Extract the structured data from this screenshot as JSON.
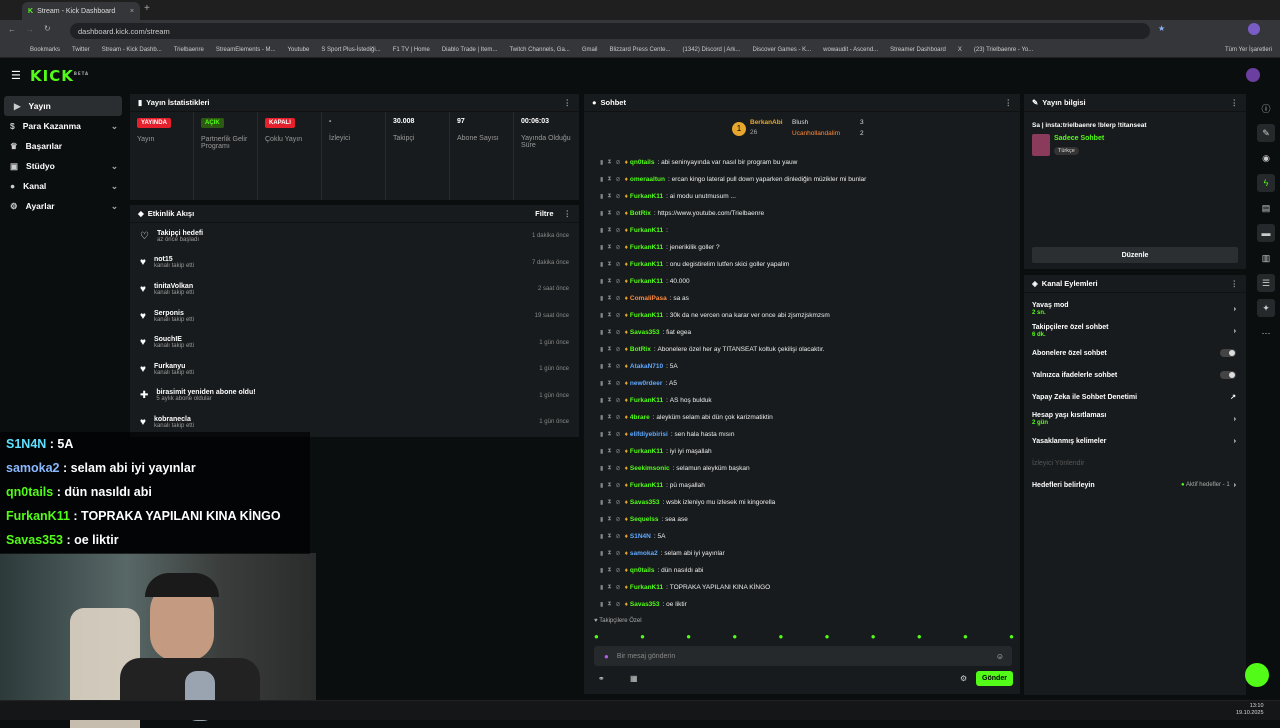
{
  "browser": {
    "tab_title": "Stream - Kick Dashboard",
    "url": "dashboard.kick.com/stream",
    "bookmarks": [
      "Bookmarks",
      "Twitter",
      "Stream - Kick Dashb...",
      "Trielbaenre",
      "StreamElements - M...",
      "Youtube",
      "S Sport Plus-İstediği...",
      "F1 TV | Home",
      "Diablo Trade | Item...",
      "Twitch Channels, Ga...",
      "Gmail",
      "Blizzard Press Cente...",
      "(1342) Discord | Ark...",
      "Discover Games - K...",
      "wowaudit - Ascend...",
      "Streamer Dashboard",
      "X",
      "(23) Trielbaenre - Yo..."
    ],
    "all_bookmarks": "Tüm Yer İşaretleri"
  },
  "app": {
    "logo": "KICK",
    "beta": "BETA"
  },
  "sidebar": {
    "items": [
      {
        "label": "Yayın"
      },
      {
        "label": "Para Kazanma"
      },
      {
        "label": "Başarılar"
      },
      {
        "label": "Stüdyo"
      },
      {
        "label": "Kanal"
      },
      {
        "label": "Ayarlar"
      }
    ]
  },
  "stats": {
    "title": "Yayın İstatistikleri",
    "items": [
      {
        "badge": "YAYINDA",
        "badge_color": "#e5202d",
        "label": "Yayın"
      },
      {
        "badge": "AÇIK",
        "badge_color": "#53fc18",
        "label": "Partnerlik Gelir Programı"
      },
      {
        "badge": "KAPALI",
        "badge_color": "#e5202d",
        "label": "Çoklu Yayın"
      },
      {
        "value": "-",
        "label": "İzleyici"
      },
      {
        "value": "30.008",
        "label": "Takipçi"
      },
      {
        "value": "97",
        "label": "Abone Sayısı"
      },
      {
        "value": "00:06:03",
        "label": "Yayında Olduğu Süre"
      }
    ]
  },
  "activity": {
    "title": "Etkinlik Akışı",
    "filter": "Filtre",
    "items": [
      {
        "name": "Takipçi hedefi",
        "sub": "az önce başladı",
        "time": "1 dakika önce"
      },
      {
        "name": "not15",
        "sub": "kanalı takip etti",
        "time": "7 dakika önce"
      },
      {
        "name": "tinitaVolkan",
        "sub": "kanalı takip etti",
        "time": "2 saat önce"
      },
      {
        "name": "Serponis",
        "sub": "kanalı takip etti",
        "time": "19 saat önce"
      },
      {
        "name": "SouchIE",
        "sub": "kanalı takip etti",
        "time": "1 gün önce"
      },
      {
        "name": "Furkanyu",
        "sub": "kanalı takip etti",
        "time": "1 gün önce"
      },
      {
        "name": "birasimit yeniden abone oldu!",
        "sub": "5 aylık abone oldular",
        "time": "1 gün önce"
      },
      {
        "name": "kobranecla",
        "sub": "kanalı takip etti",
        "time": "1 gün önce"
      }
    ]
  },
  "chat": {
    "title": "Sohbet",
    "top": [
      {
        "name": "BerkanAbi",
        "count": "26"
      },
      {
        "name": "Blush",
        "count": "3"
      },
      {
        "name": "Ucanhollandalim",
        "count": "2"
      }
    ],
    "messages": [
      {
        "user": "qn0tails",
        "color": "#53fc18",
        "text": "abi seninyayında var nasıl bir program bu yauw"
      },
      {
        "user": "omeraaltun",
        "color": "#53fc18",
        "text": "ercan kingo lateral pull down yaparken dinlediğin müzikler mi bunlar"
      },
      {
        "user": "FurkanK11",
        "color": "#53fc18",
        "text": "ai modu unutmusum ..."
      },
      {
        "user": "BotRix",
        "color": "#53fc18",
        "text": "https://www.youtube.com/Trielbaenre"
      },
      {
        "user": "FurkanK11",
        "color": "#53fc18",
        "text": ""
      },
      {
        "user": "FurkanK11",
        "color": "#53fc18",
        "text": "jenerikilik goller ?"
      },
      {
        "user": "FurkanK11",
        "color": "#53fc18",
        "text": "onu degistirelim lutfen skici goller yapalim"
      },
      {
        "user": "FurkanK11",
        "color": "#53fc18",
        "text": "40.000"
      },
      {
        "user": "ComaliPasa",
        "color": "#ff8a3c",
        "text": "sa as"
      },
      {
        "user": "FurkanK11",
        "color": "#53fc18",
        "text": "30k da ne vercen ona karar ver once abi zjsmzjskmzsm"
      },
      {
        "user": "Savas353",
        "color": "#53fc18",
        "text": "fiat egea"
      },
      {
        "user": "BotRix",
        "color": "#53fc18",
        "text": "Abonelere özel her ay TITANSEAT koltuk çekilişi olacaktır."
      },
      {
        "user": "AtakaN710",
        "color": "#5fa8ff",
        "text": "5A"
      },
      {
        "user": "new0rdeer",
        "color": "#5fa8ff",
        "text": "A5"
      },
      {
        "user": "FurkanK11",
        "color": "#53fc18",
        "text": "AS hoş bulduk"
      },
      {
        "user": "4brare",
        "color": "#53fc18",
        "text": "aleyküm selam abi dün çok karizmatiktin"
      },
      {
        "user": "elifdiyebirisi",
        "color": "#5fa8ff",
        "text": "sen hala hasta mısın"
      },
      {
        "user": "FurkanK11",
        "color": "#53fc18",
        "text": "iyi iyi maşallah"
      },
      {
        "user": "Seekimsonic",
        "color": "#53fc18",
        "text": "selamun aleyküm başkan"
      },
      {
        "user": "FurkanK11",
        "color": "#53fc18",
        "text": "pü maşallah"
      },
      {
        "user": "Savas353",
        "color": "#53fc18",
        "text": "wsbk izleniyo mu izlesek mi kingorella"
      },
      {
        "user": "Sequelss",
        "color": "#53fc18",
        "text": "sea ase"
      },
      {
        "user": "S1N4N",
        "color": "#5fa8ff",
        "text": "5A"
      },
      {
        "user": "samoka2",
        "color": "#5fa8ff",
        "text": "selam abi iyi yayınlar"
      },
      {
        "user": "qn0tails",
        "color": "#53fc18",
        "text": "dün nasıldı abi"
      },
      {
        "user": "FurkanK11",
        "color": "#53fc18",
        "text": "TOPRAKA YAPILANI KINA KİNGO"
      },
      {
        "user": "Savas353",
        "color": "#53fc18",
        "text": "oe liktir"
      }
    ],
    "follower_only": "Takipçilere Özel",
    "input_placeholder": "Bir mesaj gönderin",
    "send": "Gönder"
  },
  "overlay": {
    "messages": [
      {
        "user": "S1N4N",
        "color": "#5fe0ff",
        "text": "5A"
      },
      {
        "user": "samoka2",
        "color": "#8ab8ff",
        "text": "selam abi iyi yayınlar"
      },
      {
        "user": "qn0tails",
        "color": "#53fc18",
        "text": "dün nasıldı abi"
      },
      {
        "user": "FurkanK11",
        "color": "#53fc18",
        "text": "TOPRAKA YAPILANI KINA KİNGO"
      },
      {
        "user": "Savas353",
        "color": "#53fc18",
        "text": "oe liktir"
      }
    ]
  },
  "info": {
    "title": "Yayın bilgisi",
    "stream_title": "Sa | insta:trielbaenre !blerp !titanseat",
    "category": "Sadece Sohbet",
    "tag": "Türkçe",
    "edit": "Düzenle"
  },
  "actions": {
    "title": "Kanal Eylemleri",
    "items": [
      {
        "label": "Yavaş mod",
        "sub": "2 sn."
      },
      {
        "label": "Takipçilere özel sohbet",
        "sub": "6 dk."
      },
      {
        "label": "Abonelere özel sohbet",
        "sub": ""
      },
      {
        "label": "Yalnızca ifadelerle sohbet",
        "sub": ""
      },
      {
        "label": "Yapay Zeka ile Sohbet Denetimi",
        "sub": ""
      },
      {
        "label": "Hesap yaşı kısıtlaması",
        "sub": "2 gün"
      },
      {
        "label": "Yasaklanmış kelimeler",
        "sub": ""
      },
      {
        "label": "İzleyici Yönlendir",
        "sub": ""
      },
      {
        "label": "Hedefleri belirleyin",
        "sub": ""
      }
    ],
    "goal_status": "Aktif hedefler - 1"
  },
  "taskbar": {
    "time": "13:10",
    "date": "19.10.2025"
  }
}
